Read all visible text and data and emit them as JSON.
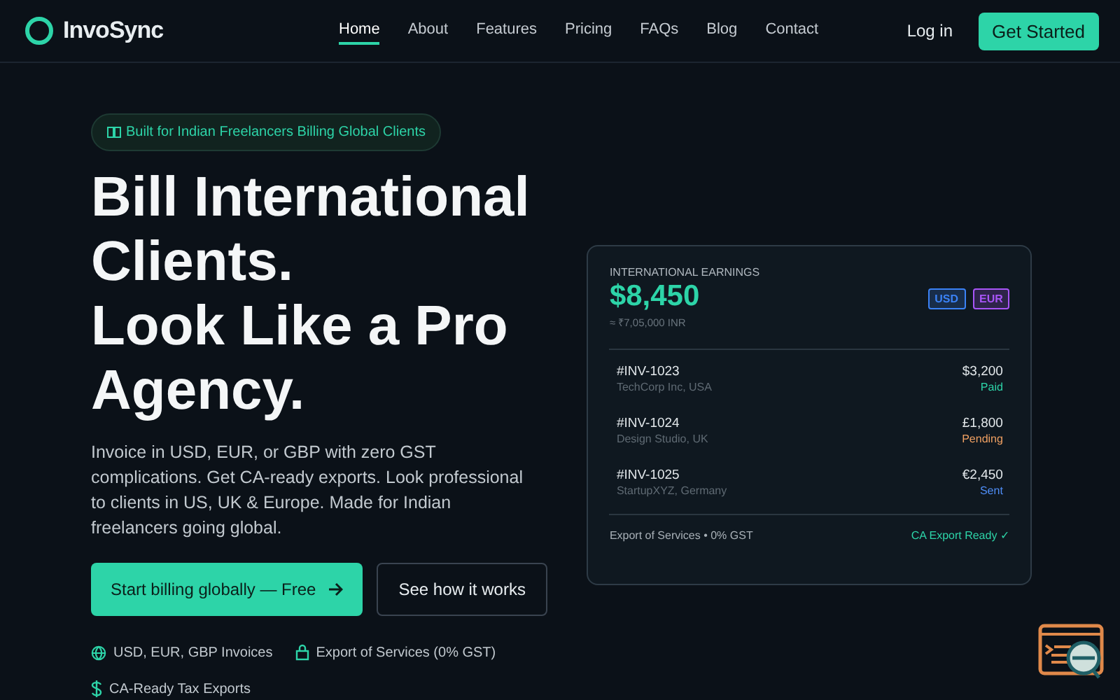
{
  "brand": {
    "name": "InvoSync"
  },
  "nav": [
    {
      "label": "Home",
      "selected": true
    },
    {
      "label": "About",
      "selected": false
    },
    {
      "label": "Features",
      "selected": false
    },
    {
      "label": "Pricing",
      "selected": false
    },
    {
      "label": "FAQs",
      "selected": false
    },
    {
      "label": "Blog",
      "selected": false
    },
    {
      "label": "Contact",
      "selected": false
    }
  ],
  "login": "Log in",
  "cta": "Get Started",
  "hero": {
    "badge": "Built for Indian Freelancers Billing Global Clients",
    "title_lines": [
      "Bill International",
      "Clients.",
      "Look Like a Pro",
      "Agency."
    ],
    "subtitle": "Invoice in USD, EUR, or GBP with zero GST complications. Get CA-ready exports. Look professional to clients in US, UK & Europe. Made for Indian freelancers going global.",
    "primary_button": "Start billing globally — Free",
    "secondary_button": "See how it works",
    "features": [
      {
        "kind": "globe",
        "label": "USD, EUR, GBP Invoices"
      },
      {
        "kind": "lock",
        "label": "Export of Services (0% GST)"
      },
      {
        "kind": "dollar",
        "label": "CA-Ready Tax Exports"
      }
    ]
  },
  "card": {
    "label": "INTERNATIONAL EARNINGS",
    "total": "$8,450",
    "converted": "≈ ₹7,05,000 INR",
    "currencies": [
      {
        "label": "USD",
        "color": "#3b82f6"
      },
      {
        "label": "EUR",
        "color": "#a855f7"
      }
    ],
    "invoices": [
      {
        "id": "#INV-1023",
        "client": "TechCorp Inc, USA",
        "amount": "$3,200",
        "status": "Paid",
        "color": "#2dd4a8"
      },
      {
        "id": "#INV-1024",
        "client": "Design Studio, UK",
        "amount": "£1,800",
        "status": "Pending",
        "color": "#f0a062"
      },
      {
        "id": "#INV-1025",
        "client": "StartupXYZ, Germany",
        "amount": "€2,450",
        "status": "Sent",
        "color": "#4f8ef7"
      }
    ],
    "footer_left": "Export of Services • 0% GST",
    "footer_right": "CA Export Ready ✓"
  }
}
